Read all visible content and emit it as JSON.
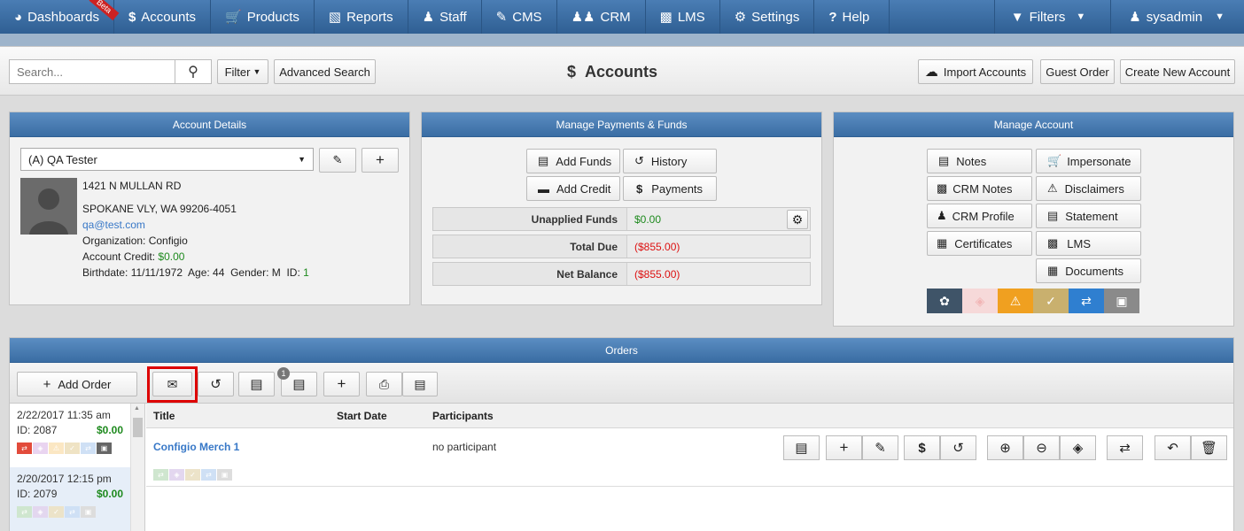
{
  "nav": {
    "dashboards": "Dashboards",
    "beta": "Beta",
    "accounts": "Accounts",
    "products": "Products",
    "reports": "Reports",
    "staff": "Staff",
    "cms": "CMS",
    "crm": "CRM",
    "lms": "LMS",
    "settings": "Settings",
    "help": "Help",
    "filters": "Filters",
    "user": "sysadmin"
  },
  "toolbar": {
    "search_placeholder": "Search...",
    "filter": "Filter",
    "advanced_search": "Advanced Search",
    "title": "Accounts",
    "import": "Import Accounts",
    "guest_order": "Guest Order",
    "create": "Create New Account"
  },
  "account_details": {
    "heading": "Account Details",
    "selected": "(A) QA Tester",
    "address1": "1421 N MULLAN RD",
    "address2": "SPOKANE VLY, WA 99206-4051",
    "email": "qa@test.com",
    "organization_label": "Organization:",
    "organization": "Configio",
    "credit_label": "Account Credit:",
    "credit": "$0.00",
    "birthdate_label": "Birthdate:",
    "birthdate": "11/11/1972",
    "age_label": "Age:",
    "age": "44",
    "gender_label": "Gender:",
    "gender": "M",
    "id_label": "ID:",
    "id": "1"
  },
  "payments": {
    "heading": "Manage Payments & Funds",
    "add_funds": "Add Funds",
    "history": "History",
    "add_credit": "Add Credit",
    "payments": "Payments",
    "rows": [
      {
        "label": "Unapplied Funds",
        "value": "$0.00",
        "status": "green"
      },
      {
        "label": "Total Due",
        "value": "($855.00)",
        "status": "red"
      },
      {
        "label": "Net Balance",
        "value": "($855.00)",
        "status": "red"
      }
    ]
  },
  "manage_account": {
    "heading": "Manage Account",
    "notes": "Notes",
    "impersonate": "Impersonate",
    "crm_notes": "CRM Notes",
    "disclaimers": "Disclaimers",
    "crm_profile": "CRM Profile",
    "statement": "Statement",
    "certificates": "Certificates",
    "lms": "LMS",
    "documents": "Documents",
    "tile_colors": [
      "#3f5468",
      "#f6d9d9",
      "#f0a020",
      "#c9b06e",
      "#2f7fd0",
      "#8a8a8a"
    ]
  },
  "orders": {
    "heading": "Orders",
    "add_order": "Add Order",
    "notes_badge": "1",
    "list": [
      {
        "date": "2/22/2017 11:35 am",
        "id": "ID: 2087",
        "amount": "$0.00"
      },
      {
        "date": "2/20/2017 12:15 pm",
        "id": "ID: 2079",
        "amount": "$0.00"
      }
    ],
    "columns": {
      "title": "Title",
      "start": "Start Date",
      "participants": "Participants"
    },
    "row": {
      "title": "Configio Merch 1",
      "start": "",
      "participants": "no participant"
    }
  }
}
